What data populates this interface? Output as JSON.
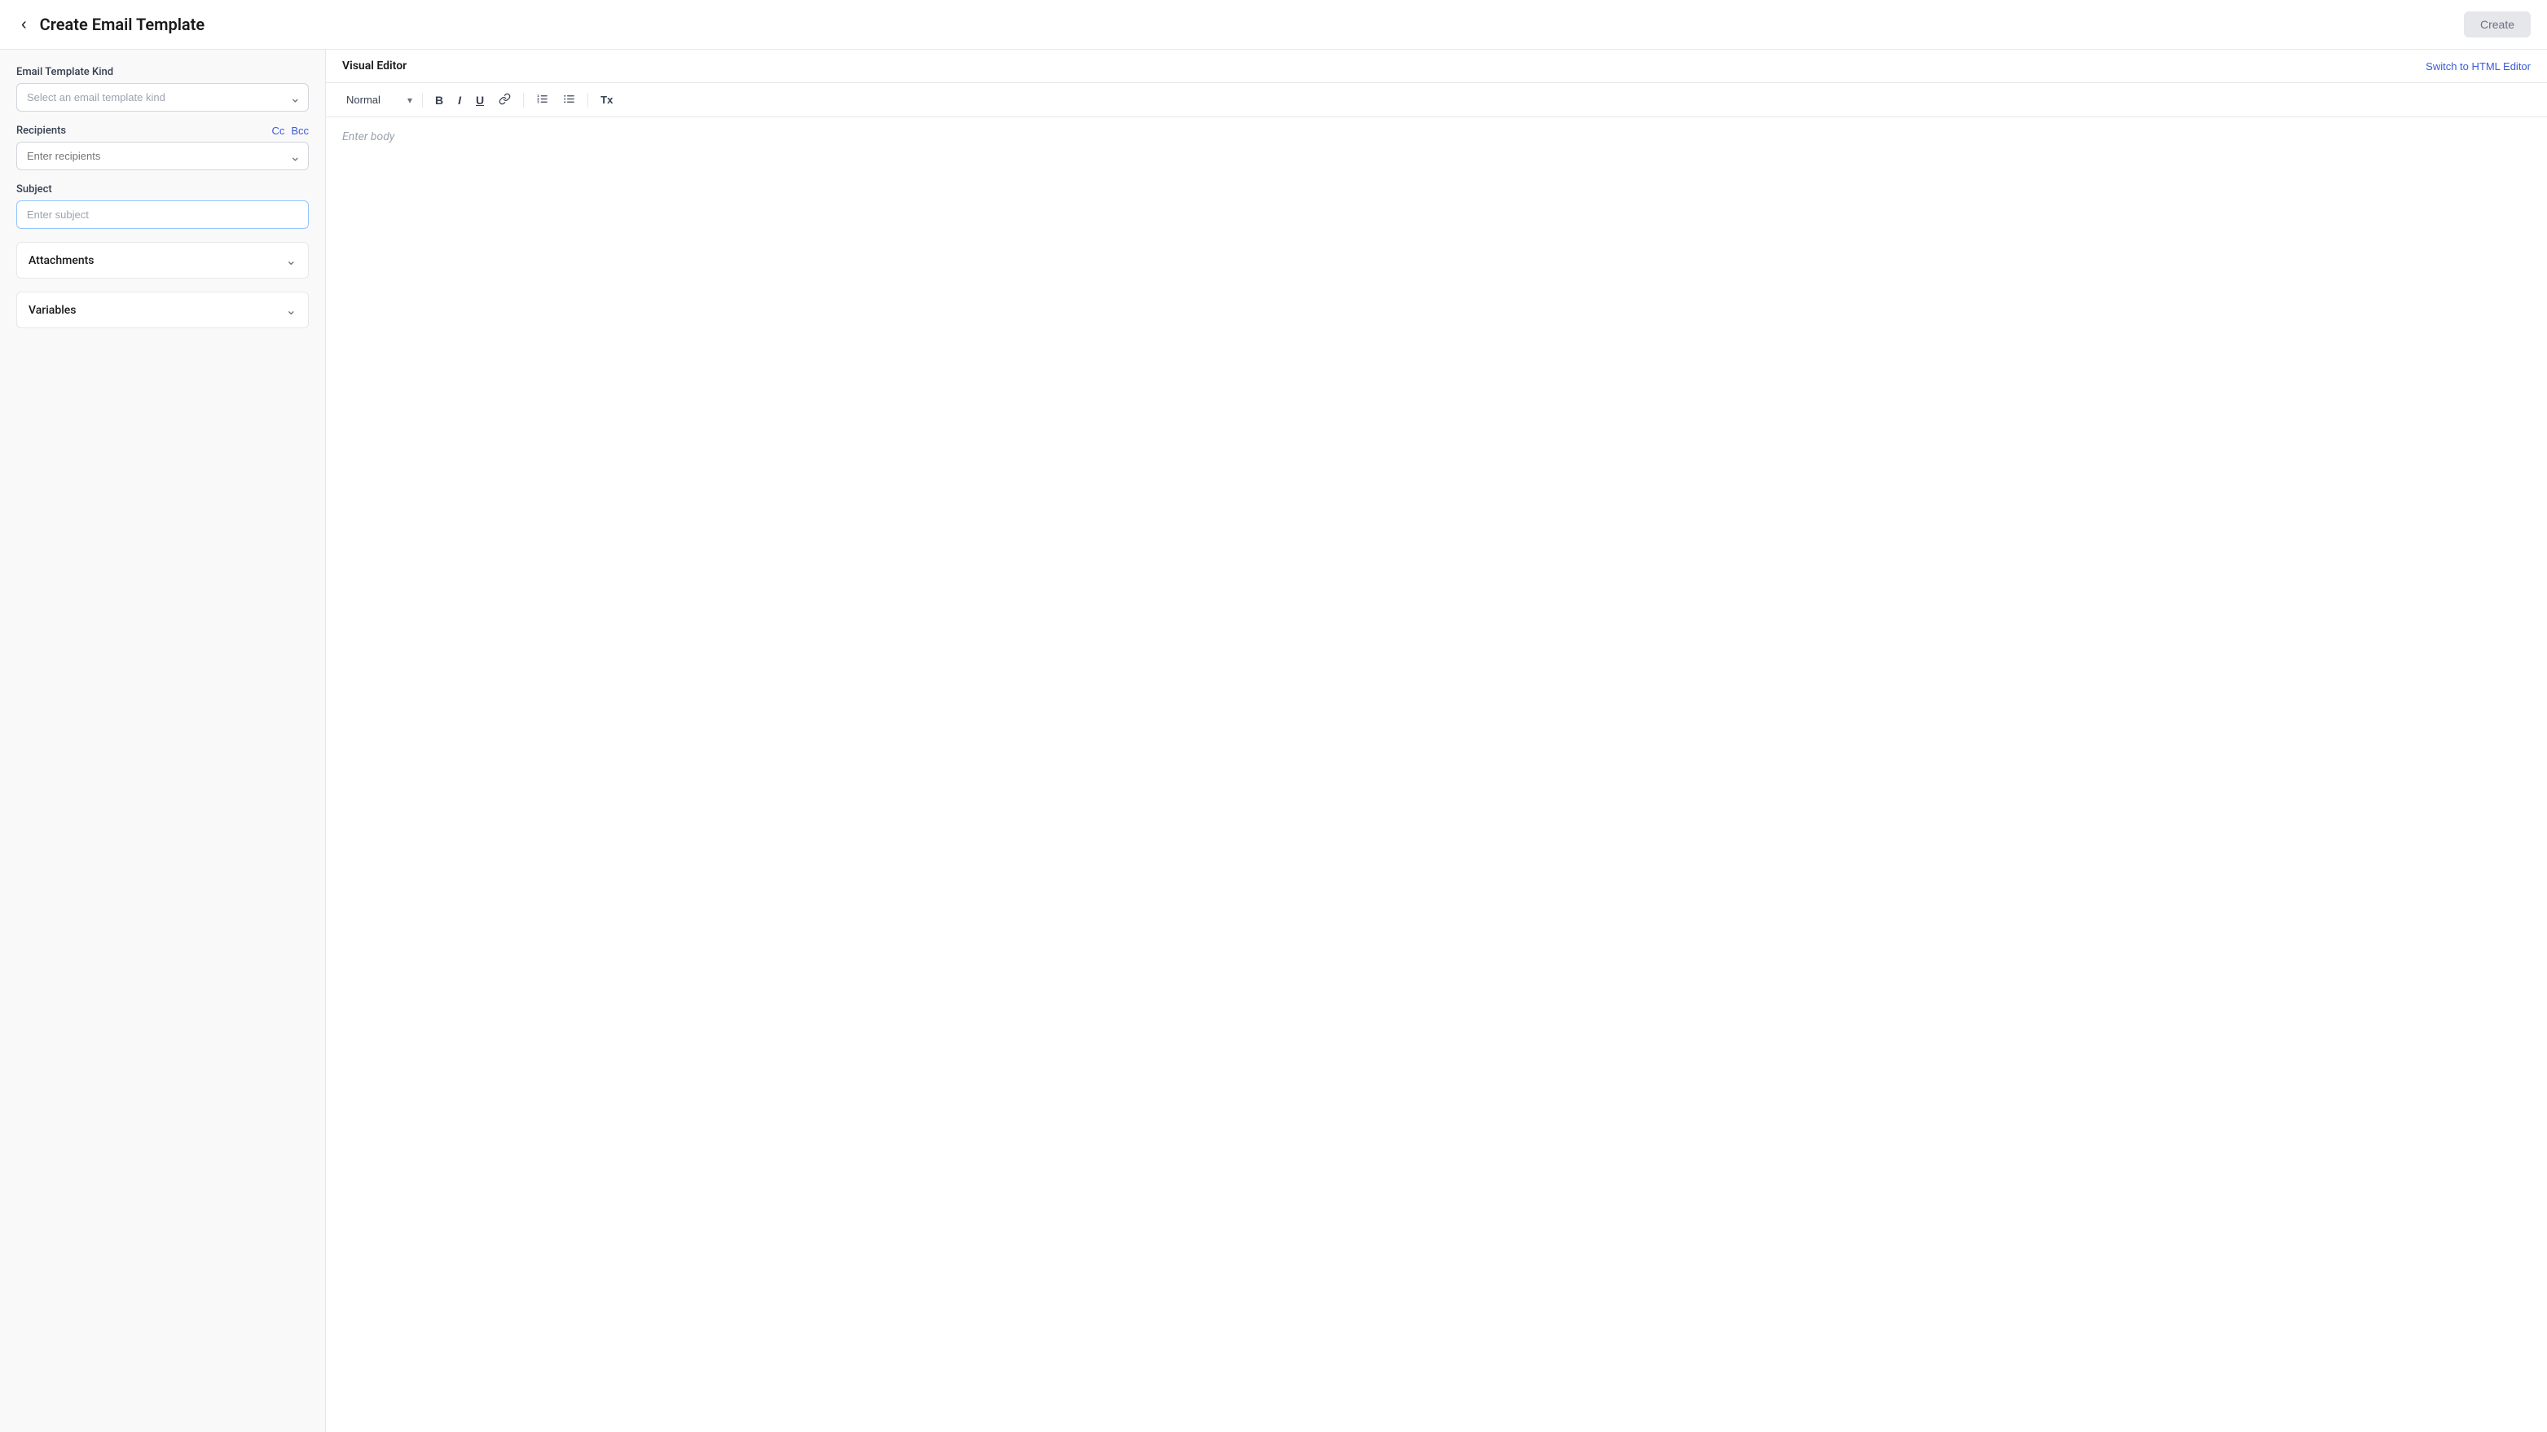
{
  "header": {
    "title": "Create Email Template",
    "back_label": "‹",
    "create_label": "Create"
  },
  "left_panel": {
    "email_template_kind": {
      "label": "Email Template Kind",
      "placeholder": "Select an email template kind"
    },
    "recipients": {
      "label": "Recipients",
      "placeholder": "Enter recipients",
      "cc_label": "Cc",
      "bcc_label": "Bcc"
    },
    "subject": {
      "label": "Subject",
      "placeholder": "Enter subject"
    },
    "attachments": {
      "label": "Attachments"
    },
    "variables": {
      "label": "Variables"
    }
  },
  "right_panel": {
    "editor_title": "Visual Editor",
    "switch_label": "Switch to HTML Editor",
    "toolbar": {
      "format_default": "Normal",
      "bold_label": "B",
      "italic_label": "I",
      "underline_label": "U",
      "link_label": "🔗",
      "ordered_list_label": "≡",
      "unordered_list_label": "≡",
      "clear_label": "Tx"
    },
    "body_placeholder": "Enter body"
  }
}
